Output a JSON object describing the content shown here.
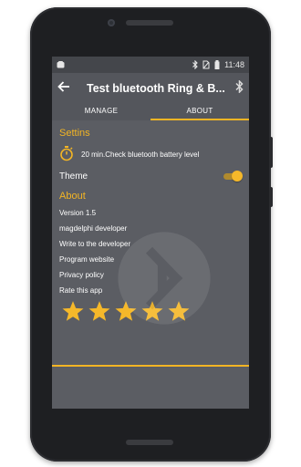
{
  "statusbar": {
    "time": "11:48"
  },
  "appbar": {
    "title": "Test bluetooth Ring & B..."
  },
  "tabs": [
    {
      "label": "MANAGE",
      "active": false
    },
    {
      "label": "ABOUT",
      "active": true
    }
  ],
  "settings": {
    "heading": "Settins",
    "timer_text": "20 min.Check bluetooth battery level",
    "theme_label": "Theme",
    "theme_on": true
  },
  "about": {
    "heading": "About",
    "version": "Version 1.5",
    "developer": "magdelphi developer",
    "write": "Write to the developer",
    "website": "Program website",
    "privacy": "Privacy policy",
    "rate": "Rate this app",
    "rating": 5,
    "rating_max": 5
  },
  "colors": {
    "accent": "#f3b524",
    "background": "#5b5d63",
    "bar": "#54565c"
  }
}
